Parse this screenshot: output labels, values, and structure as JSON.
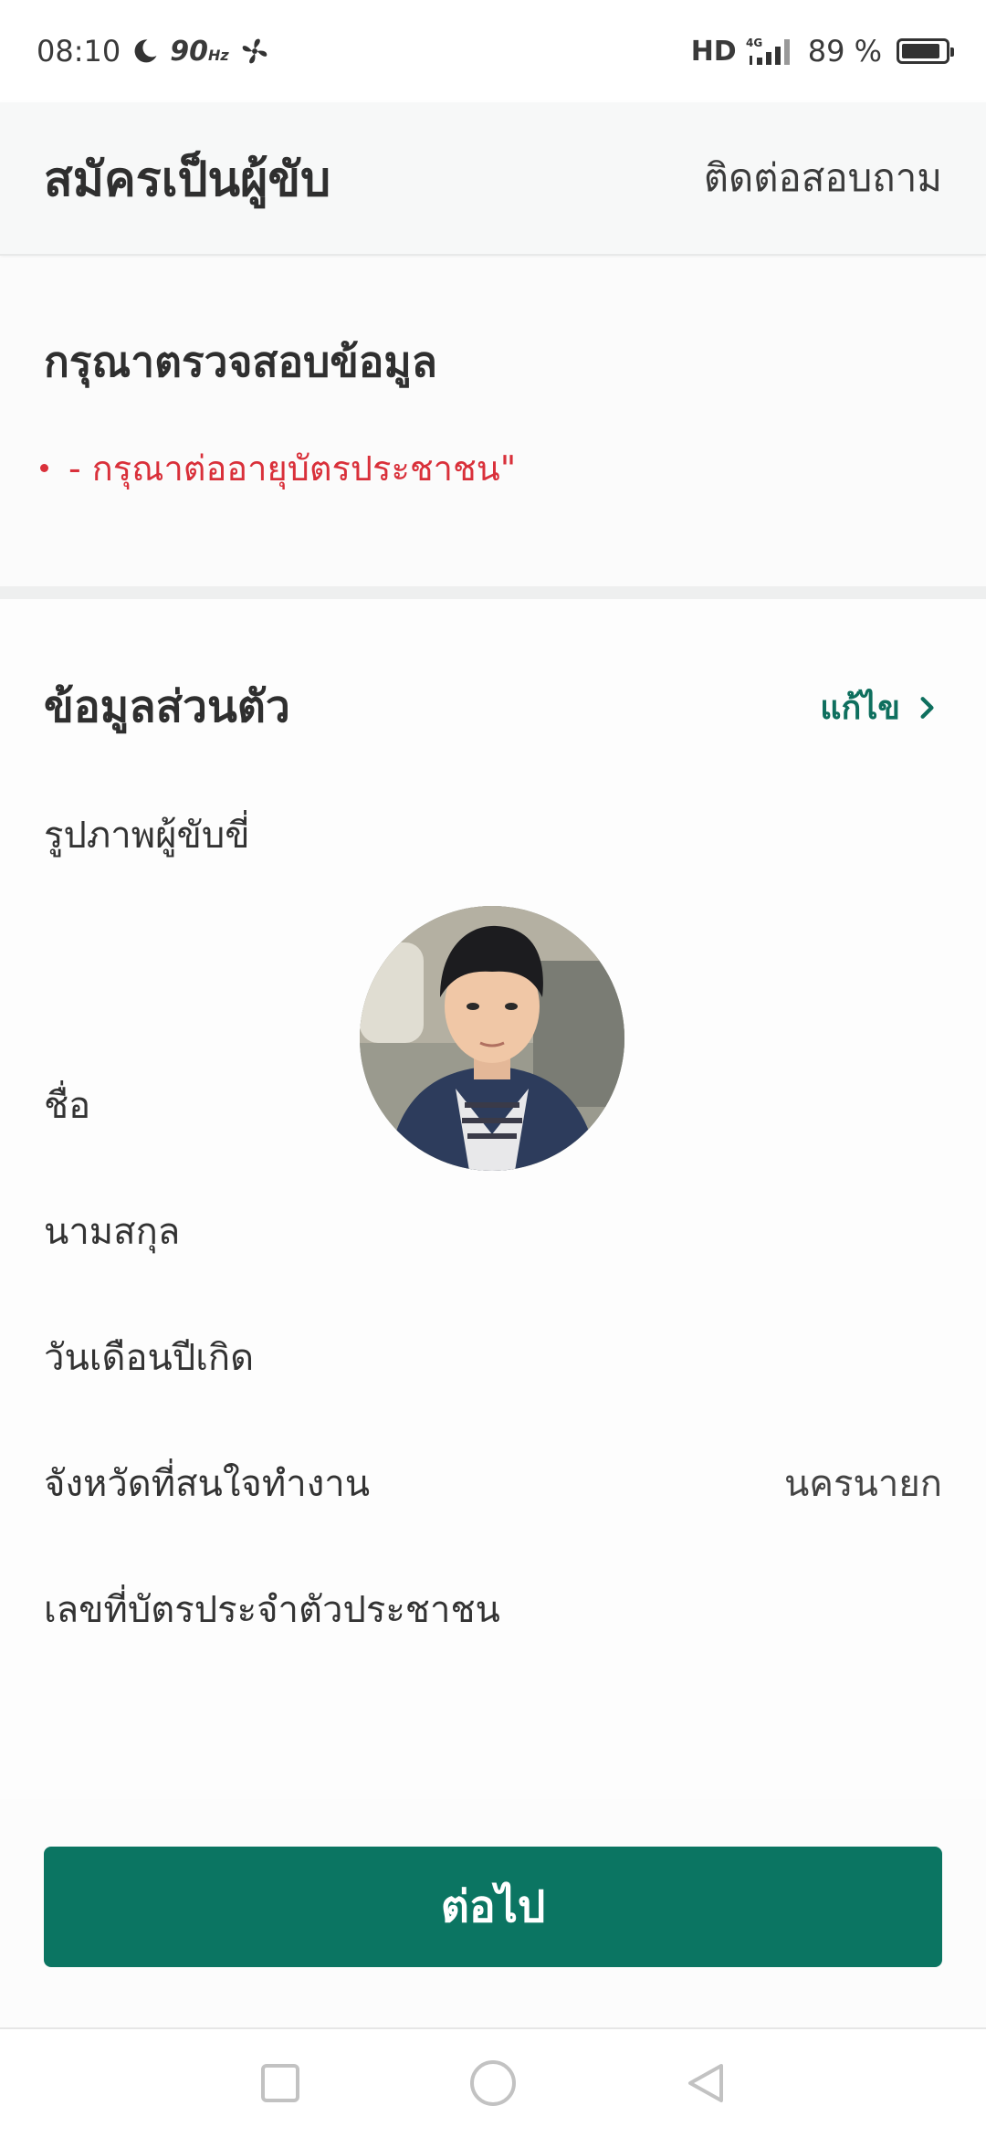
{
  "status_bar": {
    "time": "08:10",
    "refresh_rate": "90",
    "refresh_unit": "Hz",
    "hd": "HD",
    "network": "4G",
    "battery_percent": "89 %",
    "battery_level": 0.89,
    "icons": [
      "moon-icon",
      "fan-icon",
      "signal-icon",
      "battery-icon"
    ]
  },
  "header": {
    "title": "สมัครเป็นผู้ขับ",
    "contact_label": "ติดต่อสอบถาม"
  },
  "verification": {
    "title": "กรุณาตรวจสอบข้อมูล",
    "messages": [
      "- กรุณาต่ออายุบัตรประชาชน\""
    ],
    "error_color": "#d9303a"
  },
  "personal_info": {
    "title": "ข้อมูลส่วนตัว",
    "edit_label": "แก้ไข",
    "accent_color": "#0e6f5e",
    "photo_label": "รูปภาพผู้ขับขี่",
    "rows": [
      {
        "label": "ชื่อ",
        "value": ""
      },
      {
        "label": "นามสกุล",
        "value": ""
      },
      {
        "label": "วันเดือนปีเกิด",
        "value": ""
      },
      {
        "label": "จังหวัดที่สนใจทำงาน",
        "value": "นครนายก"
      },
      {
        "label": "เลขที่บัตรประจำตัวประชาชน",
        "value": ""
      }
    ]
  },
  "footer": {
    "next_label": "ต่อไป",
    "button_color": "#0b7562"
  },
  "nav_bar": {
    "icons": [
      "recent-apps-icon",
      "home-icon",
      "back-icon"
    ]
  }
}
